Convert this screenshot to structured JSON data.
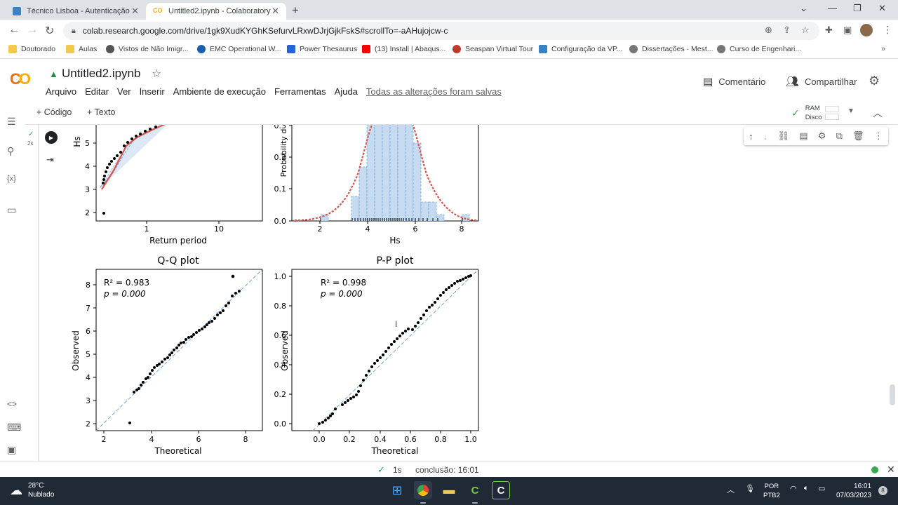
{
  "browser": {
    "tabs": [
      {
        "title": "Técnico Lisboa - Autenticação",
        "active": false
      },
      {
        "title": "Untitled2.ipynb - Colaboratory",
        "active": true
      }
    ],
    "url": "colab.research.google.com/drive/1gk9XudKYGhKSefurvLRxwDJrjGjkFskS#scrollTo=-aAHujojcw-c",
    "bookmarks": [
      "Doutorado",
      "Aulas",
      "Vistos de Não Imigr...",
      "EMC Operational W...",
      "Power Thesaurus",
      "(13) Install | Abaqus...",
      "Seaspan Virtual Tour",
      "Configuração da VP...",
      "Dissertações · Mest...",
      "Curso de Engenhari..."
    ]
  },
  "colab": {
    "notebook_title": "Untitled2.ipynb",
    "menu": [
      "Arquivo",
      "Editar",
      "Ver",
      "Inserir",
      "Ambiente de execução",
      "Ferramentas",
      "Ajuda"
    ],
    "saved_status": "Todas as alterações foram salvas",
    "comment_label": "Comentário",
    "share_label": "Compartilhar",
    "add_code_label": "+ Código",
    "add_text_label": "+ Texto",
    "ram_label": "RAM",
    "disk_label": "Disco",
    "cell_exec_time": "2s"
  },
  "plots": {
    "return_level": {
      "ylabel": "Hs",
      "xlabel": "Return period",
      "yticks": [
        "2",
        "3",
        "4",
        "5"
      ],
      "xticks": [
        "1",
        "10"
      ]
    },
    "pdf": {
      "ylabel": "Probability d",
      "xlabel": "Hs",
      "yticks": [
        "0.0",
        "0.1",
        "0.2",
        "0.3"
      ],
      "xticks": [
        "2",
        "4",
        "6",
        "8"
      ]
    },
    "qq": {
      "title": "Q-Q plot",
      "xlabel": "Theoretical",
      "ylabel": "Observed",
      "r2": "R² = 0.983",
      "p": "p = 0.000",
      "xticks": [
        "2",
        "4",
        "6",
        "8"
      ],
      "yticks": [
        "2",
        "3",
        "4",
        "5",
        "6",
        "7",
        "8"
      ]
    },
    "pp": {
      "title": "P-P plot",
      "xlabel": "Theoretical",
      "ylabel": "Observed",
      "r2": "R² = 0.998",
      "p": "p = 0.000",
      "xticks": [
        "0.0",
        "0.2",
        "0.4",
        "0.6",
        "0.8",
        "1.0"
      ],
      "yticks": [
        "0.0",
        "0.2",
        "0.4",
        "0.6",
        "0.8",
        "1.0"
      ]
    }
  },
  "status_bar": {
    "time": "1s",
    "completion": "conclusão: 16:01"
  },
  "taskbar": {
    "temperature": "28°C",
    "weather": "Nublado",
    "lang_line1": "POR",
    "lang_line2": "PTB2",
    "time": "16:01",
    "date": "07/03/2023",
    "notif_count": "8"
  },
  "colors": {
    "fit_line": "#d9534f",
    "bar_fill": "#c6dbef",
    "reference_line": "#6fa8dc",
    "accent_green": "#34a853"
  }
}
